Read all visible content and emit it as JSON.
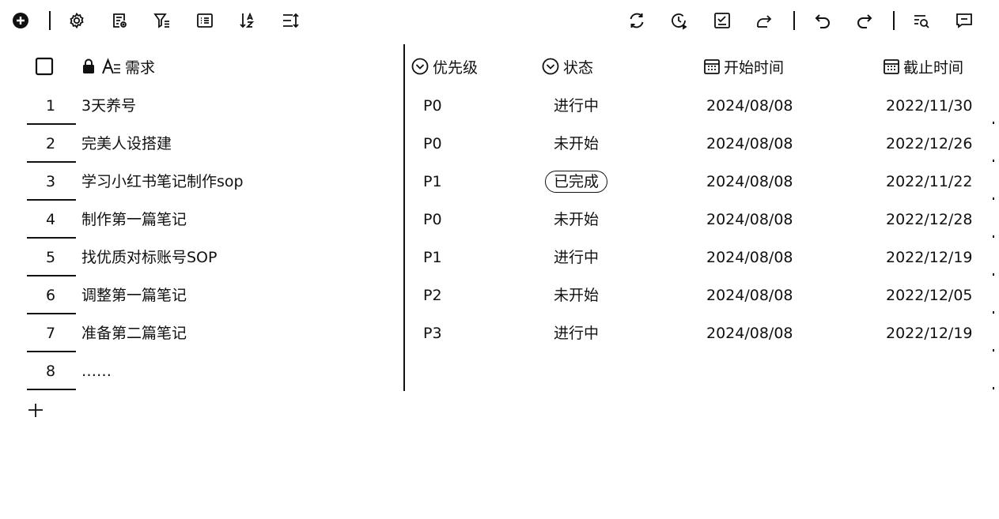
{
  "toolbar": {
    "left": [
      "add-icon",
      "settings-icon",
      "form-icon",
      "filter-icon",
      "list-view-icon",
      "sort-az-icon",
      "row-height-icon"
    ],
    "right": [
      "sync-icon",
      "history-icon",
      "check-task-icon",
      "share-icon",
      "undo-icon",
      "redo-icon",
      "search-icon",
      "comment-icon"
    ]
  },
  "columns": {
    "requirement": "需求",
    "priority": "优先级",
    "status": "状态",
    "start": "开始时间",
    "due": "截止时间"
  },
  "rows": [
    {
      "num": "1",
      "req": "3天养号",
      "priority": "P0",
      "status": "进行中",
      "start": "2024/08/08",
      "due": "2022/11/30"
    },
    {
      "num": "2",
      "req": "完美人设搭建",
      "priority": "P0",
      "status": "未开始",
      "start": "2024/08/08",
      "due": "2022/12/26"
    },
    {
      "num": "3",
      "req": "学习小红书笔记制作sop",
      "priority": "P1",
      "status": "已完成",
      "start": "2024/08/08",
      "due": "2022/11/22"
    },
    {
      "num": "4",
      "req": "制作第一篇笔记",
      "priority": "P0",
      "status": "未开始",
      "start": "2024/08/08",
      "due": "2022/12/28"
    },
    {
      "num": "5",
      "req": "找优质对标账号SOP",
      "priority": "P1",
      "status": "进行中",
      "start": "2024/08/08",
      "due": "2022/12/19"
    },
    {
      "num": "6",
      "req": "调整第一篇笔记",
      "priority": "P2",
      "status": "未开始",
      "start": "2024/08/08",
      "due": "2022/12/05"
    },
    {
      "num": "7",
      "req": "准备第二篇笔记",
      "priority": "P3",
      "status": "进行中",
      "start": "2024/08/08",
      "due": "2022/12/19"
    },
    {
      "num": "8",
      "req": "……",
      "priority": "",
      "status": "",
      "start": "",
      "due": ""
    }
  ],
  "highlighted_status": "已完成"
}
